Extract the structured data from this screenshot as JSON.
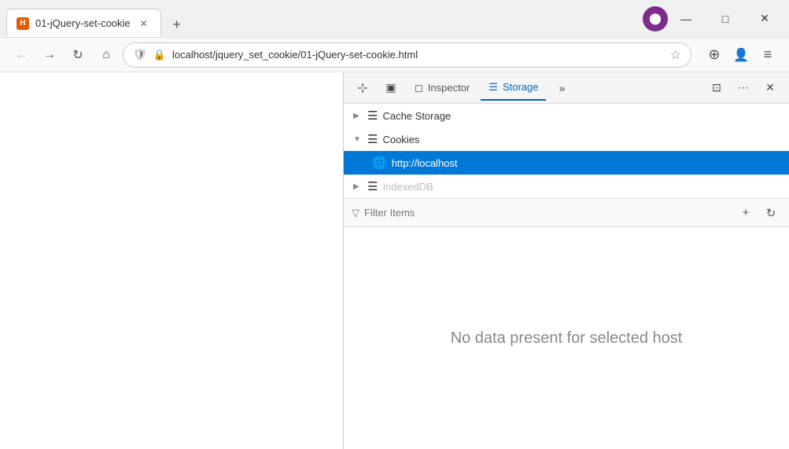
{
  "browser": {
    "tab_title": "01-jQuery-set-cookie",
    "tab_icon_text": "H",
    "new_tab_icon": "+",
    "window_controls": {
      "minimize": "—",
      "maximize": "□",
      "close": "✕"
    }
  },
  "navbar": {
    "back_icon": "←",
    "forward_icon": "→",
    "reload_icon": "↻",
    "home_icon": "⌂",
    "shield_icon": "🛡",
    "url": "localhost/jquery_set_cookie/01-jQuery-set-cookie.html",
    "bookmark_icon": "☆",
    "pocket_icon": "⊕",
    "profile_icon": "👤",
    "menu_icon": "≡",
    "avatar_letter": "●"
  },
  "devtools": {
    "tools": {
      "pick_icon": "⊹",
      "frames_icon": "▣"
    },
    "tabs": [
      {
        "label": "Inspector",
        "icon": "◻",
        "active": false
      },
      {
        "label": "Storage",
        "icon": "☰",
        "active": true
      }
    ],
    "more_icon": "»",
    "dock_icon": "⊡",
    "options_icon": "⋯",
    "close_icon": "✕"
  },
  "storage_tree": {
    "items": [
      {
        "id": "cache-storage",
        "arrow": "▶",
        "icon": "☰",
        "label": "Cache Storage",
        "expanded": false,
        "selected": false,
        "children": []
      },
      {
        "id": "cookies",
        "arrow": "▼",
        "icon": "☰",
        "label": "Cookies",
        "expanded": true,
        "selected": false,
        "children": [
          {
            "id": "localhost-cookies",
            "icon": "🌐",
            "label": "http://localhost",
            "selected": true
          }
        ]
      },
      {
        "id": "indexed-db",
        "arrow": "▶",
        "icon": "☰",
        "label": "IndexedDB",
        "expanded": false,
        "selected": false
      }
    ]
  },
  "filter_bar": {
    "icon": "▽",
    "placeholder": "Filter Items",
    "add_icon": "+",
    "refresh_icon": "↻"
  },
  "main_content": {
    "no_data_text": "No data present for selected host"
  }
}
